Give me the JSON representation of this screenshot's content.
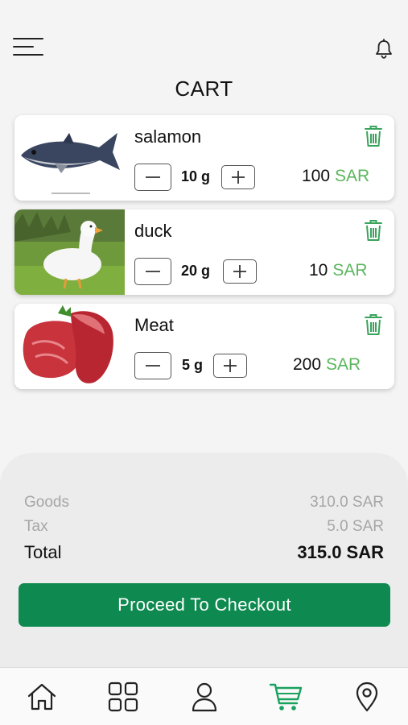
{
  "header": {
    "title": "CART",
    "menu_icon": "hamburger-menu-icon",
    "notification_icon": "bell-icon"
  },
  "cart": {
    "items": [
      {
        "name": "salamon",
        "quantity": "10 g",
        "price": "100",
        "currency": "SAR",
        "image": "tuna-fish-photo"
      },
      {
        "name": "duck",
        "quantity": "20 g",
        "price": "10",
        "currency": "SAR",
        "image": "white-duck-photo"
      },
      {
        "name": "Meat",
        "quantity": "5 g",
        "price": "200",
        "currency": "SAR",
        "image": "raw-beef-photo"
      }
    ]
  },
  "summary": {
    "goods_label": "Goods",
    "goods_value": "310.0 SAR",
    "tax_label": "Tax",
    "tax_value": "5.0 SAR",
    "total_label": "Total",
    "total_value": "315.0 SAR"
  },
  "checkout": {
    "label": "Proceed To Checkout"
  },
  "bottom_nav": {
    "active": "cart",
    "items": [
      "home-icon",
      "categories-grid-icon",
      "profile-icon",
      "cart-icon",
      "location-pin-icon"
    ]
  },
  "colors": {
    "primary": "#0e8a50",
    "accent_green": "#5bb65e",
    "trash_green": "#3aa35c",
    "cart_active": "#19a15f"
  }
}
